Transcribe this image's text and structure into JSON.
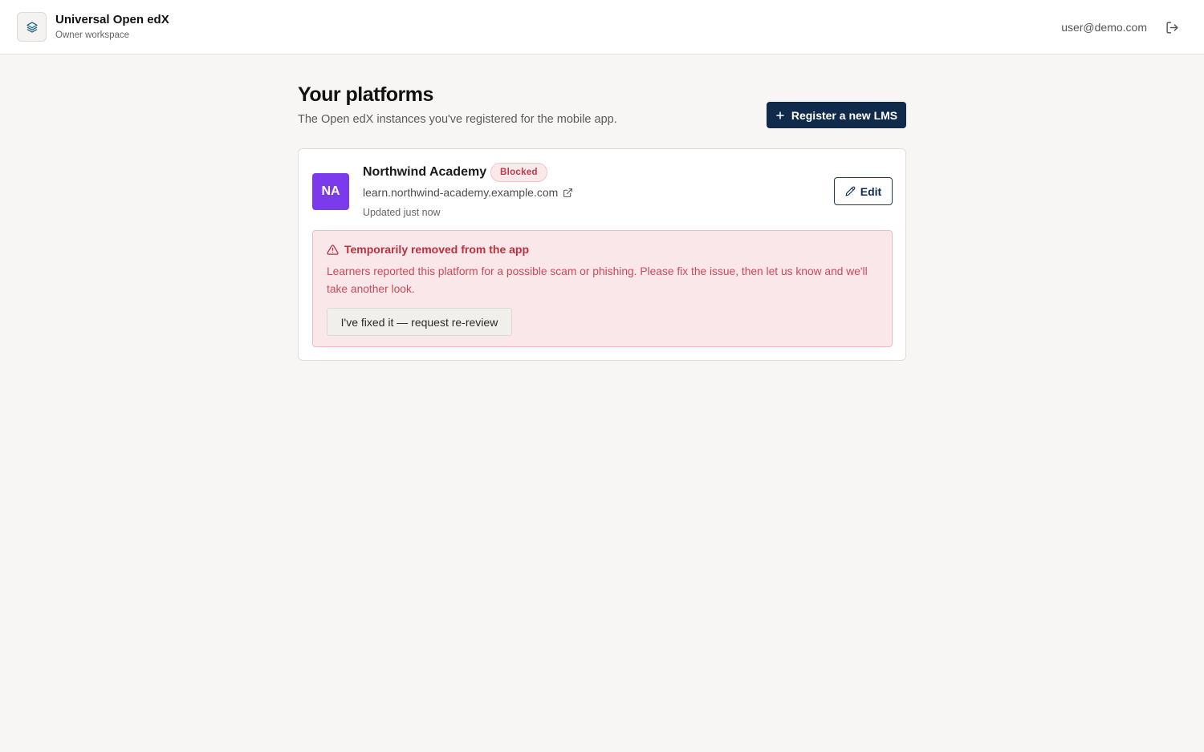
{
  "header": {
    "app_title": "Universal Open edX",
    "workspace": "Owner workspace",
    "user_email": "user@demo.com",
    "icons": {
      "logo": "layers-icon",
      "logout": "logout-icon"
    }
  },
  "page": {
    "title": "Your platforms",
    "subtitle": "The Open edX instances you've registered for the mobile app.",
    "register_label": "Register a new LMS"
  },
  "platforms": [
    {
      "initials": "NA",
      "avatar_color": "#7c3aed",
      "name": "Northwind Academy",
      "status": "Blocked",
      "url": "learn.northwind-academy.example.com",
      "updated": "Updated just now",
      "edit_label": "Edit",
      "alert": {
        "title": "Temporarily removed from the app",
        "body": "Learners reported this platform for a possible scam or phishing. Please fix the issue, then let us know and we'll take another look.",
        "action_label": "I've fixed it — request re-review"
      }
    }
  ],
  "colors": {
    "primary": "#0f2a4a",
    "danger": "#b8313f",
    "danger_bg": "#f9e7e9",
    "background": "#f7f6f4"
  }
}
